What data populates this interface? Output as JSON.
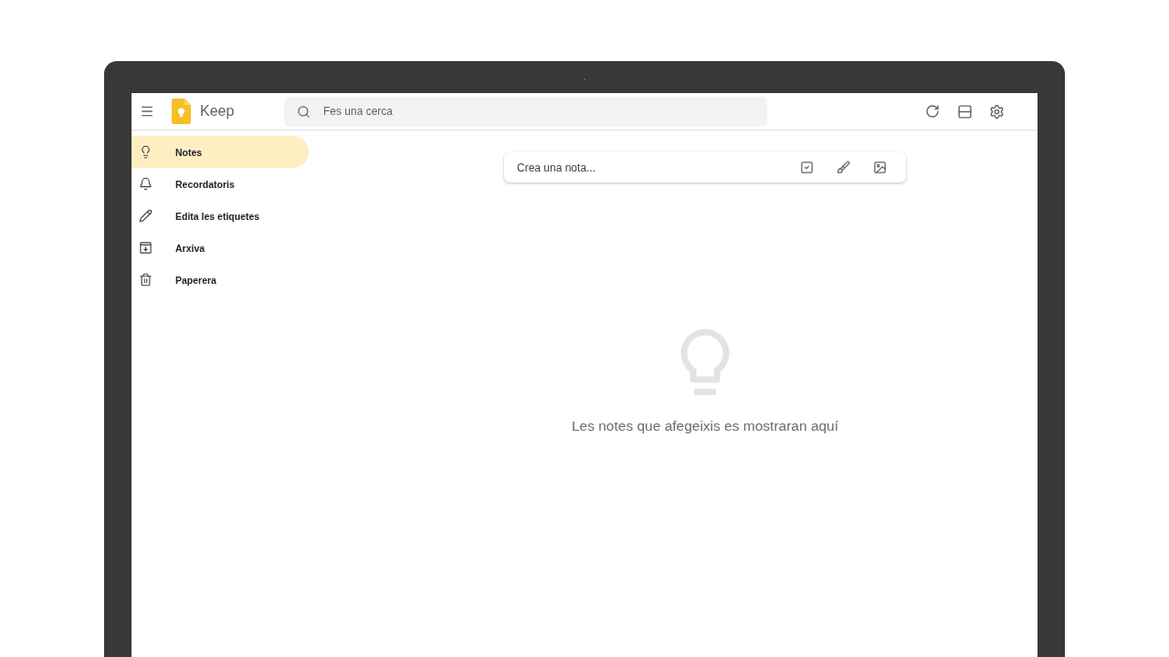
{
  "app": {
    "title": "Keep"
  },
  "search": {
    "placeholder": "Fes una cerca"
  },
  "sidebar": {
    "items": [
      {
        "label": "Notes",
        "selected": true
      },
      {
        "label": "Recordatoris",
        "selected": false
      },
      {
        "label": "Edita les etiquetes",
        "selected": false
      },
      {
        "label": "Arxiva",
        "selected": false
      },
      {
        "label": "Paperera",
        "selected": false
      }
    ]
  },
  "note_composer": {
    "placeholder": "Crea una nota..."
  },
  "empty_state": {
    "message": "Les notes que afegeixis es mostraran aquí"
  }
}
